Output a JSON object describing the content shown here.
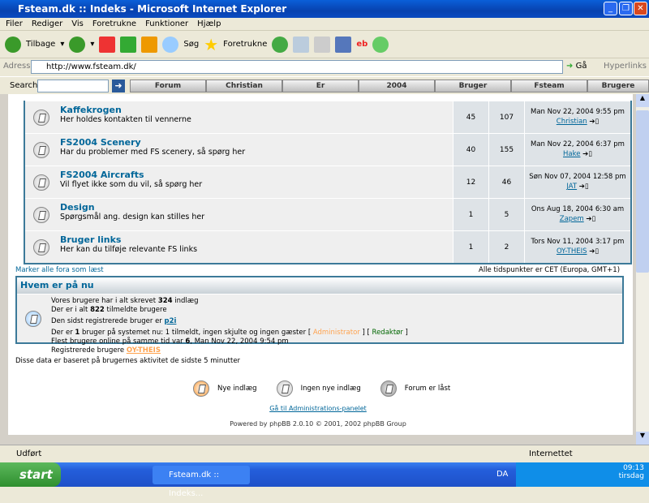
{
  "window": {
    "title": "Fsteam.dk :: Indeks - Microsoft Internet Explorer"
  },
  "menu": [
    "Filer",
    "Rediger",
    "Vis",
    "Foretrukne",
    "Funktioner",
    "Hjælp"
  ],
  "toolbar": {
    "back": "Tilbage",
    "search": "Søg",
    "favorites": "Foretrukne"
  },
  "address": {
    "label": "Adresse",
    "url": "http://www.fsteam.dk/",
    "go": "Gå",
    "links": "Hyperlinks"
  },
  "searchbar": {
    "label": "Search",
    "tabs": [
      "Forum",
      "Christian",
      "Er",
      "2004",
      "Bruger",
      "Fsteam",
      "Brugere"
    ]
  },
  "forums": [
    {
      "name": "Kaffekrogen",
      "desc": "Her holdes kontakten til vennerne",
      "topics": "45",
      "posts": "107",
      "last_date": "Man Nov 22, 2004 9:55 pm",
      "last_user": "Christian"
    },
    {
      "name": "FS2004 Scenery",
      "desc": "Har du problemer med FS scenery, så spørg her",
      "topics": "40",
      "posts": "155",
      "last_date": "Man Nov 22, 2004 6:37 pm",
      "last_user": "Hake"
    },
    {
      "name": "FS2004 Aircrafts",
      "desc": "Vil flyet ikke som du vil, så spørg her",
      "topics": "12",
      "posts": "46",
      "last_date": "Søn Nov 07, 2004 12:58 pm",
      "last_user": "JAT"
    },
    {
      "name": "Design",
      "desc": "Spørgsmål ang. design kan stilles her",
      "topics": "1",
      "posts": "5",
      "last_date": "Ons Aug 18, 2004 6:30 am",
      "last_user": "Zapem"
    },
    {
      "name": "Bruger links",
      "desc": "Her kan du tilføje relevante FS links",
      "topics": "1",
      "posts": "2",
      "last_date": "Tors Nov 11, 2004 3:17 pm",
      "last_user": "OY-THEIS"
    }
  ],
  "mark_read": "Marker alle fora som læst",
  "timezone": "Alle tidspunkter er CET (Europa, GMT+1)",
  "who": {
    "title": "Hvem er på nu",
    "l1a": "Vores brugere har i alt skrevet ",
    "l1b": "324",
    "l1c": " indlæg",
    "l2a": "Der er i alt ",
    "l2b": "822",
    "l2c": " tilmeldte brugere",
    "l3a": "Den sidst registrerede bruger er ",
    "l3b": "p2i",
    "l4a": "Der er ",
    "l4b": "1",
    "l4c": " bruger på systemet nu: 1 tilmeldt, ingen skjulte og ingen gæster  [ ",
    "admin": "Administrator",
    "mod": "Redaktør",
    "l5a": "Flest brugere online på samme tid var ",
    "l5b": "6",
    "l5c": ", Man Nov 22, 2004 9:54 pm",
    "l6a": "Registrerede brugere ",
    "l6b": "OY-THEIS"
  },
  "activity_note": "Disse data er baseret på brugernes aktivitet de sidste 5 minutter",
  "legend": {
    "new": "Nye indlæg",
    "nonew": "Ingen nye indlæg",
    "locked": "Forum er låst"
  },
  "admin_link": "Gå til Administrations-panelet",
  "powered": "Powered by phpBB 2.0.10 © 2001, 2002 phpBB Group",
  "status": {
    "text": "Udført",
    "zone": "Internettet"
  },
  "taskbar": {
    "start": "start",
    "task": "Fsteam.dk :: Indeks...",
    "lang": "DA",
    "time": "09:13",
    "day": "tirsdag"
  },
  "colors": {
    "link": "#006699",
    "border": "#3c7a99",
    "admin": "#ffa34f",
    "mod": "#006600"
  }
}
